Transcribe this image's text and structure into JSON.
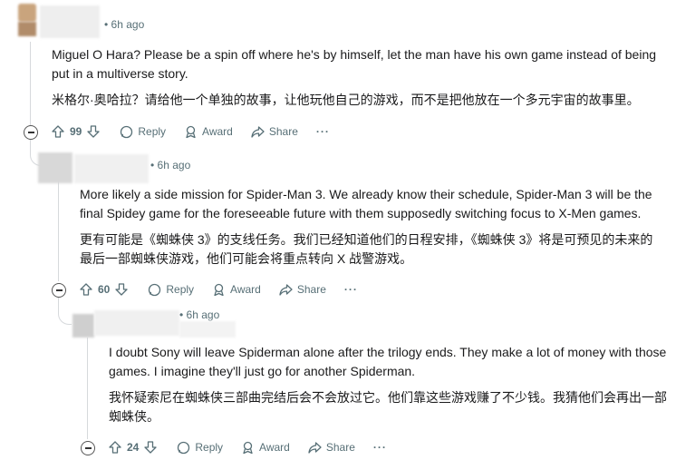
{
  "comments": [
    {
      "time": "6h ago",
      "body_en": "Miguel O Hara? Please be a spin off where he's by himself, let the man have his own game instead of being put in a multiverse story.",
      "body_zh": "米格尔·奥哈拉？请给他一个单独的故事，让他玩他自己的游戏，而不是把他放在一个多元宇宙的故事里。",
      "votes": "99"
    },
    {
      "time": "6h ago",
      "body_en": "More likely a side mission for Spider-Man 3. We already know their schedule, Spider-Man 3 will be the final Spidey game for the foreseeable future with them supposedly switching focus to X-Men games.",
      "body_zh": "更有可能是《蜘蛛侠 3》的支线任务。我们已经知道他们的日程安排，《蜘蛛侠 3》将是可预见的未来的最后一部蜘蛛侠游戏，他们可能会将重点转向 X 战警游戏。",
      "votes": "60"
    },
    {
      "time": "6h ago",
      "body_en": "I doubt Sony will leave Spiderman alone after the trilogy ends. They make a lot of money with those games. I imagine they'll just go for another Spiderman.",
      "body_zh": "我怀疑索尼在蜘蛛侠三部曲完结后会不会放过它。他们靠这些游戏赚了不少钱。我猜他们会再出一部蜘蛛侠。",
      "votes": "24"
    }
  ],
  "actions": {
    "reply": "Reply",
    "award": "Award",
    "share": "Share",
    "more": "···"
  },
  "time_prefix": "•"
}
